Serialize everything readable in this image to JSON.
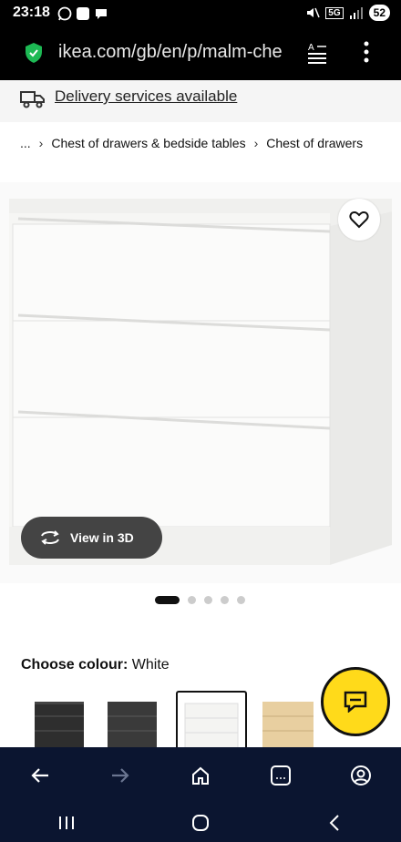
{
  "status_bar": {
    "time": "23:18",
    "network": "5G",
    "battery": "52"
  },
  "browser": {
    "url": "ikea.com/gb/en/p/malm-che"
  },
  "delivery": {
    "text": "Delivery services available"
  },
  "breadcrumb": {
    "items": [
      "...",
      "Chest of drawers & bedside tables",
      "Chest of drawers"
    ]
  },
  "product": {
    "view3d_label": "View in 3D",
    "image_count": 5,
    "active_image": 1
  },
  "colour": {
    "label": "Choose colour:",
    "selected": "White",
    "options": [
      {
        "name": "black-brown",
        "color": "#2e2e2e"
      },
      {
        "name": "dark-grey",
        "color": "#3a3a3a"
      },
      {
        "name": "white",
        "color": "#f4f4f2"
      },
      {
        "name": "oak-veneer",
        "color": "#e8cfa0"
      }
    ]
  },
  "colors": {
    "ikea_yellow": "#ffda1a",
    "nav_bg": "#0b1530",
    "pill_bg": "#444444"
  }
}
